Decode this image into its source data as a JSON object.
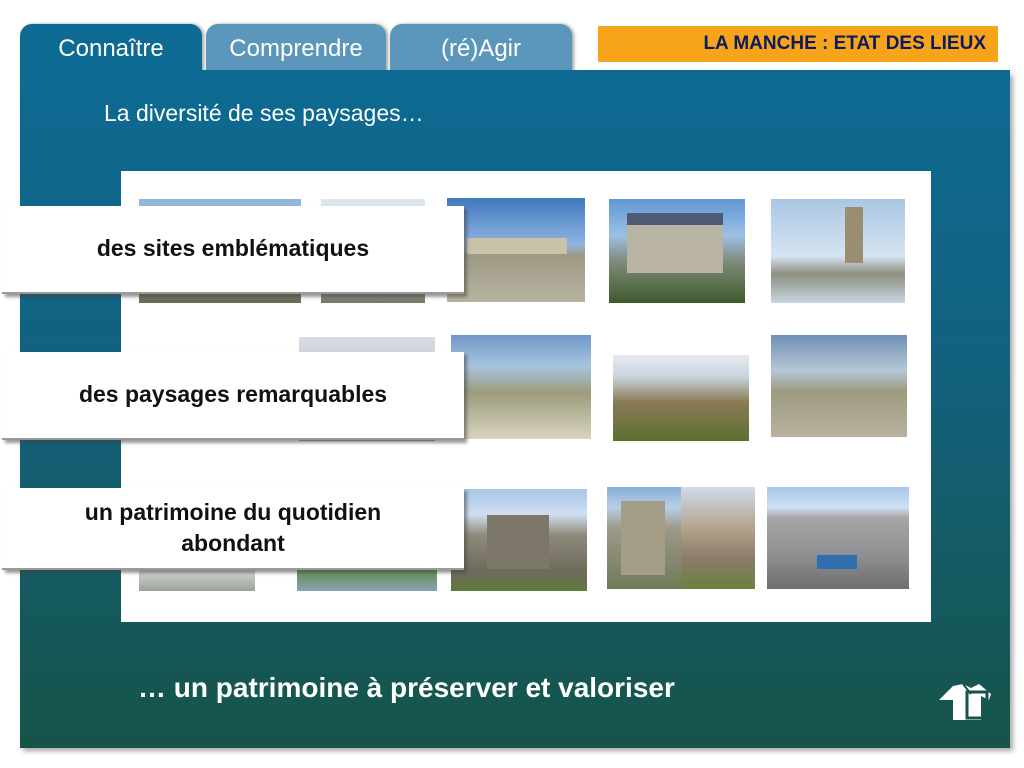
{
  "tabs": [
    {
      "label": "Connaître",
      "active": true
    },
    {
      "label": "Comprendre",
      "active": false
    },
    {
      "label": "(ré)Agir",
      "active": false
    }
  ],
  "header_badge": "LA MANCHE : ETAT DES LIEUX",
  "subtitle": "La diversité de ses paysages…",
  "callouts": [
    "des sites emblématiques",
    "des paysages remarquables",
    "un patrimoine du quotidien abondant"
  ],
  "footer": "… un patrimoine à préserver et valoriser",
  "icons": {
    "home": "home-shirt-icon"
  },
  "colors": {
    "panel_top": "#0d6a93",
    "panel_bottom": "#165449",
    "tab_inactive": "#5b97bb",
    "badge": "#f7a41a",
    "badge_text": "#0b1b5e"
  }
}
